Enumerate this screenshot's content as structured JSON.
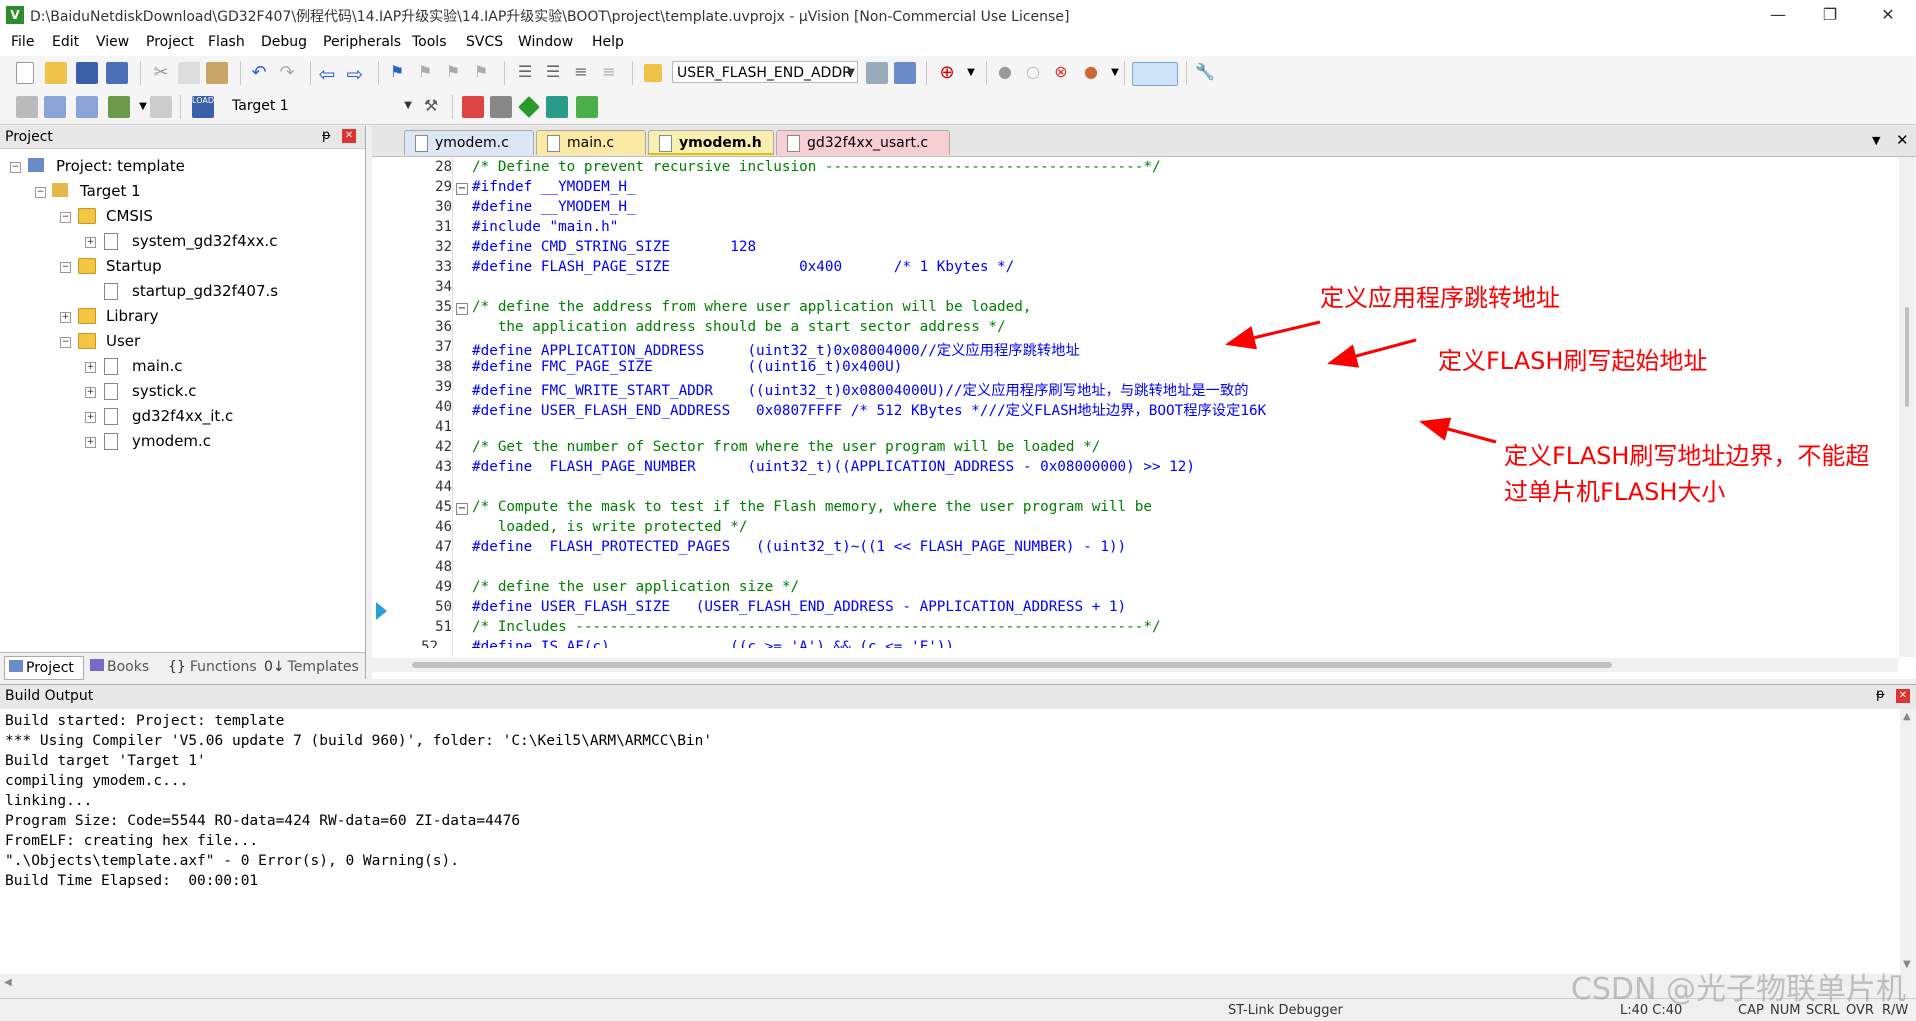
{
  "window": {
    "title": "D:\\BaiduNetdiskDownload\\GD32F407\\例程代码\\14.IAP升级实验\\14.IAP升级实验\\BOOT\\project\\template.uvprojx - µVision  [Non-Commercial Use License]",
    "minimize": "—",
    "maximize": "❐",
    "close": "✕"
  },
  "menu": [
    "File",
    "Edit",
    "View",
    "Project",
    "Flash",
    "Debug",
    "Peripherals",
    "Tools",
    "SVCS",
    "Window",
    "Help"
  ],
  "toolbar": {
    "find_combo": "USER_FLASH_END_ADDR",
    "target_combo": "Target 1"
  },
  "project_panel": {
    "title": "Project",
    "pin": "ᵽ",
    "close": "✕",
    "tree": [
      {
        "label": "Project: template"
      },
      {
        "label": "Target 1"
      },
      {
        "label": "CMSIS"
      },
      {
        "label": "system_gd32f4xx.c"
      },
      {
        "label": "Startup"
      },
      {
        "label": "startup_gd32f407.s"
      },
      {
        "label": "Library"
      },
      {
        "label": "User"
      },
      {
        "label": "main.c"
      },
      {
        "label": "systick.c"
      },
      {
        "label": "gd32f4xx_it.c"
      },
      {
        "label": "ymodem.c"
      }
    ],
    "tabs": [
      "Project",
      "Books",
      "Functions",
      "Templates"
    ]
  },
  "editor": {
    "tabs": [
      {
        "label": "ymodem.c",
        "color": "#dde6f4"
      },
      {
        "label": "main.c",
        "color": "#fde9a6"
      },
      {
        "label": "ymodem.h",
        "color": "#f8efb0"
      },
      {
        "label": "gd32f4xx_usart.c",
        "color": "#f7cfd3"
      }
    ],
    "lines": [
      {
        "n": "28",
        "text": "/* Define to prevent recursive inclusion -------------------------------------*/"
      },
      {
        "n": "29",
        "text": "#ifndef __YMODEM_H_"
      },
      {
        "n": "30",
        "text": "#define __YMODEM_H_"
      },
      {
        "n": "31",
        "text": "#include \"main.h\""
      },
      {
        "n": "32",
        "text": "#define CMD_STRING_SIZE       128"
      },
      {
        "n": "33",
        "text": "#define FLASH_PAGE_SIZE               0x400      /* 1 Kbytes */"
      },
      {
        "n": "34",
        "text": ""
      },
      {
        "n": "35",
        "text": "/* define the address from where user application will be loaded,"
      },
      {
        "n": "36",
        "text": "   the application address should be a start sector address */"
      },
      {
        "n": "37",
        "text": "#define APPLICATION_ADDRESS     (uint32_t)0x08004000//定义应用程序跳转地址"
      },
      {
        "n": "38",
        "text": "#define FMC_PAGE_SIZE           ((uint16_t)0x400U)"
      },
      {
        "n": "39",
        "text": "#define FMC_WRITE_START_ADDR    ((uint32_t)0x08004000U)//定义应用程序刷写地址，与跳转地址是一致的"
      },
      {
        "n": "40",
        "text": "#define USER_FLASH_END_ADDRESS   0x0807FFFF /* 512 KBytes *///定义FLASH地址边界，BOOT程序设定16K"
      },
      {
        "n": "41",
        "text": ""
      },
      {
        "n": "42",
        "text": "/* Get the number of Sector from where the user program will be loaded */"
      },
      {
        "n": "43",
        "text": "#define  FLASH_PAGE_NUMBER      (uint32_t)((APPLICATION_ADDRESS - 0x08000000) >> 12)"
      },
      {
        "n": "44",
        "text": ""
      },
      {
        "n": "45",
        "text": "/* Compute the mask to test if the Flash memory, where the user program will be"
      },
      {
        "n": "46",
        "text": "   loaded, is write protected */"
      },
      {
        "n": "47",
        "text": "#define  FLASH_PROTECTED_PAGES   ((uint32_t)~((1 << FLASH_PAGE_NUMBER) - 1))"
      },
      {
        "n": "48",
        "text": ""
      },
      {
        "n": "49",
        "text": "/* define the user application size */"
      },
      {
        "n": "50",
        "text": "#define USER_FLASH_SIZE   (USER_FLASH_END_ADDRESS - APPLICATION_ADDRESS + 1)"
      },
      {
        "n": "51",
        "text": "/* Includes ------------------------------------------------------------------*/"
      },
      {
        "n": "52",
        "text": "#define IS_AF(c)              ((c >= 'A') && (c <= 'F'))"
      }
    ],
    "annotations": {
      "a1": "定义应用程序跳转地址",
      "a2": "定义FLASH刷写起始地址",
      "a3_line1": "定义FLASH刷写地址边界，不能超",
      "a3_line2": "过单片机FLASH大小"
    }
  },
  "build_output": {
    "title": "Build Output",
    "lines": [
      "Build started: Project: template",
      "*** Using Compiler 'V5.06 update 7 (build 960)', folder: 'C:\\Keil5\\ARM\\ARMCC\\Bin'",
      "Build target 'Target 1'",
      "compiling ymodem.c...",
      "linking...",
      "Program Size: Code=5544 RO-data=424 RW-data=60 ZI-data=4476",
      "FromELF: creating hex file...",
      "\".\\Objects\\template.axf\" - 0 Error(s), 0 Warning(s).",
      "Build Time Elapsed:  00:00:01"
    ]
  },
  "status": {
    "debugger": "ST-Link Debugger",
    "position": "L:40 C:40",
    "caps": "CAP",
    "num": "NUM",
    "scrl": "SCRL",
    "ovr": "OVR",
    "rw": "R/W"
  },
  "watermark": "CSDN @光子物联单片机",
  "colors": {
    "annotation": "#ff0000",
    "comment": "#008000",
    "keyword": "#0000ff",
    "number": "#008080"
  }
}
